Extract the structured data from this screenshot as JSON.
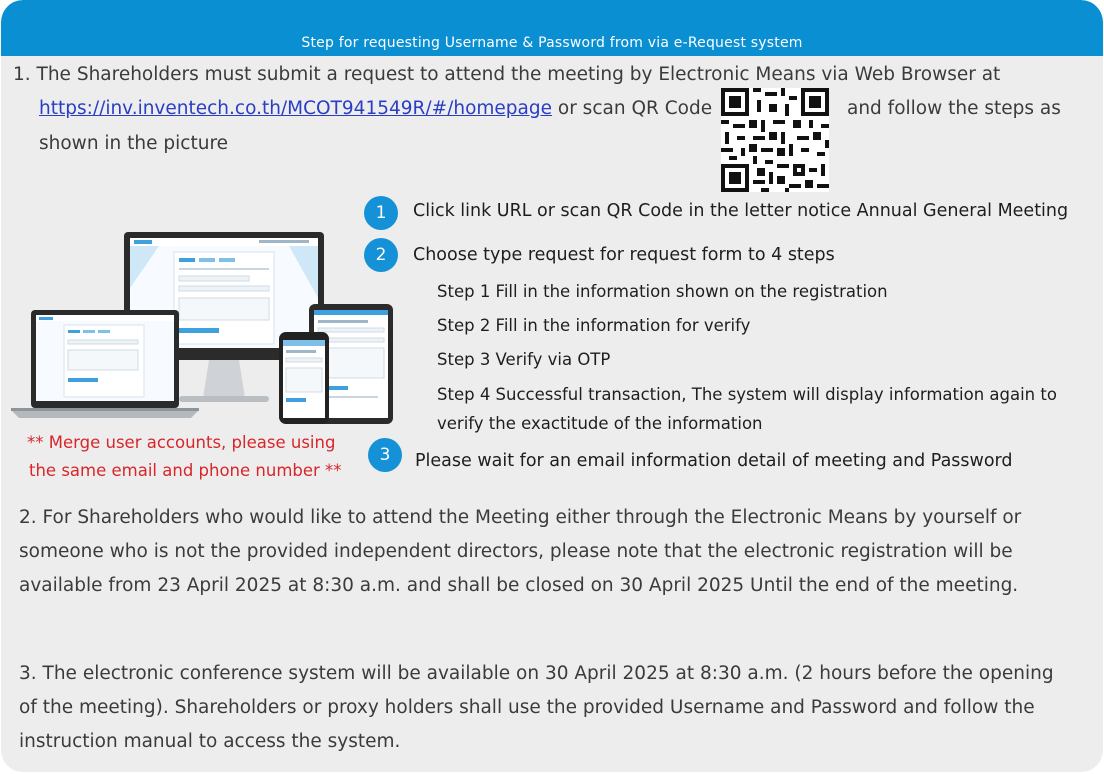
{
  "header": {
    "title": "Step for requesting Username & Password from via e-Request system"
  },
  "item1": {
    "line1": "1.  The Shareholders must submit a request to attend the meeting by Electronic Means via Web Browser at",
    "link": "https://inv.inventech.co.th/MCOT941549R/#/homepage",
    "mid": " or scan QR Code",
    "after_qr": "and follow the steps as",
    "line3": "shown in the picture"
  },
  "qr_icon": "qr-code-icon",
  "steps": {
    "s1": {
      "num": "1",
      "text": "Click link URL or scan QR Code in the letter notice Annual General Meeting"
    },
    "s2": {
      "num": "2",
      "text": "Choose type request for request form to 4 steps"
    },
    "sub1": "Step 1 Fill in the information shown on the registration",
    "sub2": "Step 2 Fill in the information for verify",
    "sub3": "Step 3 Verify via OTP",
    "sub4a": "Step 4 Successful transaction, The system will display information again to",
    "sub4b": "verify the exactitude of the information",
    "s3": {
      "num": "3",
      "text": "Please wait for an email information detail of meeting and Password"
    }
  },
  "note": {
    "line1": "** Merge user accounts, please using",
    "line2": "the same email and phone number **"
  },
  "item2": {
    "line1": "2. For Shareholders who would like to attend the Meeting either through the Electronic Means by yourself or",
    "line2": "someone who is not the provided independent directors, please note that the electronic registration will be",
    "line3": "available from 23 April 2025 at 8:30 a.m. and shall be closed on 30 April 2025 Until the end of the meeting."
  },
  "item3": {
    "line1": "3. The electronic conference system will be available on 30 April 2025 at 8:30 a.m. (2 hours before the opening",
    "line2": "of the meeting). Shareholders or proxy holders shall use the provided Username and Password and follow the",
    "line3": "instruction manual to access the system."
  },
  "colors": {
    "accent": "#0a8fd2",
    "step": "#1591d8",
    "warning": "#d8262a",
    "link": "#2a3ec4",
    "background": "#ededed"
  }
}
